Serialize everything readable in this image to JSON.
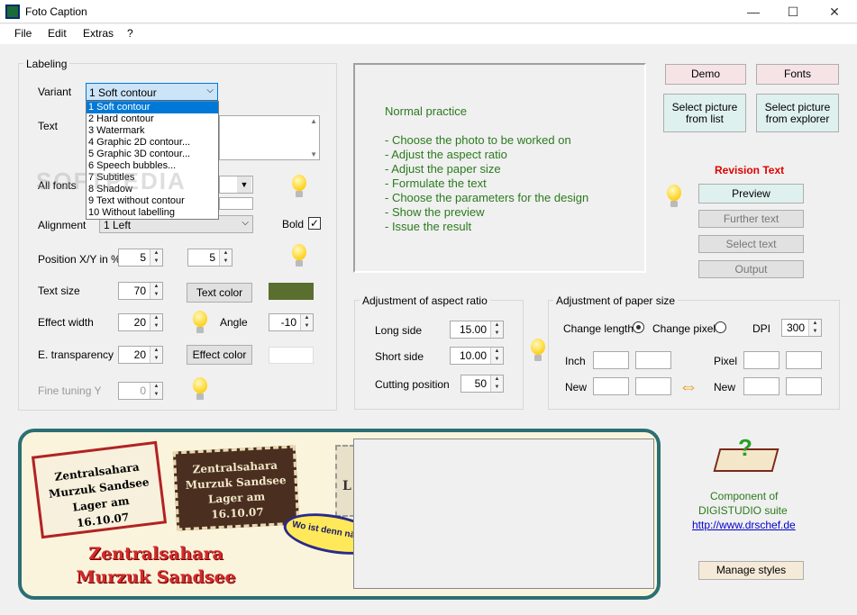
{
  "window": {
    "title": "Foto Caption",
    "minimize": "—",
    "maximize": "☐",
    "close": "✕"
  },
  "menu": [
    "File",
    "Edit",
    "Extras",
    "?"
  ],
  "labeling": {
    "legend": "Labeling",
    "variant_label": "Variant",
    "variant_value": "1 Soft contour",
    "variant_options": [
      "1 Soft contour",
      "2 Hard contour",
      "3 Watermark",
      "4 Graphic 2D contour...",
      "5 Graphic 3D contour...",
      "6 Speech bubbles...",
      "7 Subtitles",
      "8 Shadow",
      "9 Text without contour",
      "10 Without labelling"
    ],
    "text_label": "Text",
    "all_fonts_label": "All fonts",
    "alignment_label": "Alignment",
    "alignment_value": "1 Left",
    "bold_label": "Bold",
    "position_label": "Position X/Y in %",
    "pos_x": "5",
    "pos_y": "5",
    "text_size_label": "Text size",
    "text_size": "70",
    "text_color_button": "Text color",
    "text_color": "#5a6e30",
    "effect_width_label": "Effect width",
    "effect_width": "20",
    "angle_label": "Angle",
    "angle": "-10",
    "transparency_label": "E. transparency",
    "transparency": "20",
    "effect_color_button": "Effect color",
    "fine_tuning_label": "Fine tuning Y",
    "fine_tuning": "0"
  },
  "info": {
    "heading": "Normal practice",
    "steps": [
      "- Choose the photo to be worked on",
      "- Adjust the aspect ratio",
      "- Adjust the paper size",
      "- Formulate the text",
      "- Choose the parameters for the design",
      "- Show the preview",
      "- Issue the result"
    ]
  },
  "right": {
    "demo": "Demo",
    "fonts": "Fonts",
    "select_list": "Select picture from list",
    "select_explorer": "Select picture from explorer",
    "revision_heading": "Revision Text",
    "preview": "Preview",
    "further_text": "Further text",
    "select_text": "Select text",
    "output": "Output"
  },
  "aspect": {
    "legend": "Adjustment of aspect ratio",
    "long_side_label": "Long side",
    "long_side": "15.00",
    "short_side_label": "Short side",
    "short_side": "10.00",
    "cutting_label": "Cutting position",
    "cutting": "50"
  },
  "paper": {
    "legend": "Adjustment of paper size",
    "change_length": "Change length",
    "change_pixel": "Change pixel",
    "dpi_label": "DPI",
    "dpi": "300",
    "inch_label": "Inch",
    "pixel_label": "Pixel",
    "new_label": "New",
    "new_label2": "New"
  },
  "samples": {
    "stamp1": "Zentralsahara Murzuk Sandsee Lager am 16.10.07",
    "stamp2": "Zentralsahara Murzuk Sandsee Lager am 16.10.07",
    "bubble": "Wo ist denn nächste Su",
    "big_text": "Zentralsahara Murzuk Sandsee",
    "partial_text": "L"
  },
  "component": {
    "line1": "Component of",
    "line2": "DIGISTUDIO suite",
    "url": "http://www.drschef.de",
    "manage_styles": "Manage styles"
  },
  "watermark": "SOFTPEDIA"
}
